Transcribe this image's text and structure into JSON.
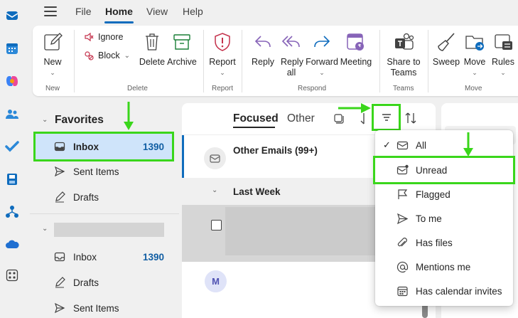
{
  "menu_tabs": [
    "File",
    "Home",
    "View",
    "Help"
  ],
  "active_tab": "Home",
  "ribbon": {
    "new": {
      "label": "New",
      "group": "New"
    },
    "ignore": "Ignore",
    "block": "Block",
    "delete": "Delete",
    "archive": "Archive",
    "delete_group": "Delete",
    "report": {
      "label": "Report",
      "group": "Report"
    },
    "reply": "Reply",
    "reply_all": "Reply all",
    "forward": "Forward",
    "meeting": "Meeting",
    "respond_group": "Respond",
    "share_to_teams": "Share to Teams",
    "teams_group": "Teams",
    "sweep": "Sweep",
    "move": "Move",
    "rules": "Rules",
    "move_group": "Move"
  },
  "folder_pane": {
    "favorites_title": "Favorites",
    "favorites": [
      {
        "label": "Inbox",
        "count": "1390"
      },
      {
        "label": "Sent Items",
        "count": ""
      },
      {
        "label": "Drafts",
        "count": ""
      }
    ],
    "account_items": [
      {
        "label": "Inbox",
        "count": "1390"
      },
      {
        "label": "Drafts",
        "count": ""
      },
      {
        "label": "Sent Items",
        "count": ""
      }
    ]
  },
  "message_list": {
    "tab_focused": "Focused",
    "tab_other": "Other",
    "other_emails": "Other Emails (99+)",
    "section": "Last Week",
    "avatar_initial": "M"
  },
  "filter_menu": {
    "items": [
      {
        "label": "All",
        "icon": "mail-icon",
        "checked": true
      },
      {
        "label": "Unread",
        "icon": "unread-mail-icon",
        "checked": false
      },
      {
        "label": "Flagged",
        "icon": "flag-icon",
        "checked": false
      },
      {
        "label": "To me",
        "icon": "send-icon",
        "checked": false
      },
      {
        "label": "Has files",
        "icon": "attachment-icon",
        "checked": false
      },
      {
        "label": "Mentions me",
        "icon": "mention-icon",
        "checked": false
      },
      {
        "label": "Has calendar invites",
        "icon": "calendar-icon",
        "checked": false
      }
    ]
  },
  "colors": {
    "accent": "#0f6cbd",
    "highlight": "#3ad61b",
    "count": "#115ea3"
  }
}
